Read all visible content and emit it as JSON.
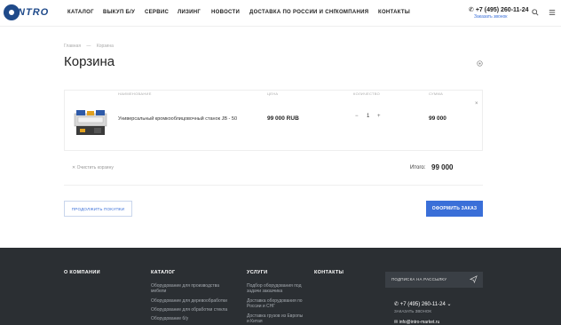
{
  "header": {
    "logo_text": "INTRO",
    "nav": [
      "КАТАЛОГ",
      "ВЫКУП Б/У",
      "СЕРВИС",
      "ЛИЗИНГ",
      "НОВОСТИ",
      "ДОСТАВКА ПО РОССИИ И СНГ",
      "КОМПАНИЯ",
      "КОНТАКТЫ"
    ],
    "phone": "+7 (495) 260-11-24",
    "callback": "Заказать звонок",
    "search_icon": "search-icon",
    "menu_icon": "menu-icon"
  },
  "breadcrumb": {
    "home": "Главная",
    "sep": "—",
    "current": "Корзина"
  },
  "page_title": "Корзина",
  "cart": {
    "headers": {
      "name": "НАИМЕНОВАНИЕ",
      "price": "ЦЕНА",
      "qty": "КОЛИЧЕСТВО",
      "sum": "СУММА"
    },
    "items": [
      {
        "name": "Универсальный кромкооблицовочный станок JB - 50",
        "price": "99 000 RUB",
        "qty": "1",
        "sum": "99 000"
      }
    ],
    "minus": "−",
    "plus": "+",
    "remove": "×",
    "clear_label": "Очистить корзину",
    "total_label": "Итого:",
    "total_value": "99 000"
  },
  "buttons": {
    "continue": "ПРОДОЛЖИТЬ ПОКУПКИ",
    "order": "ОФОРМИТЬ ЗАКАЗ"
  },
  "footer": {
    "col1_title": "О КОМПАНИИ",
    "col2_title": "КАТАЛОГ",
    "col2_links": [
      "Оборудование для производства мебели",
      "Оборудование для деревообработки",
      "Оборудование для обработки стекла",
      "Оборудование б/у"
    ],
    "col3_title": "УСЛУГИ",
    "col3_links": [
      "Подбор оборудования под задачи заказчика",
      "Доставка оборудования по России и СНГ",
      "Доставка грузов из Европы и Китая"
    ],
    "col4_title": "КОНТАКТЫ",
    "subscribe": "ПОДПИСКА НА РАССЫЛКУ",
    "phone": "+7 (495) 260-11-24",
    "callback": "ЗАКАЗАТЬ ЗВОНОК",
    "email": "info@intro-market.ru"
  },
  "colors": {
    "accent": "#3a6fd8",
    "footer_bg": "#2b2f33",
    "logo": "#1f4a8a"
  }
}
